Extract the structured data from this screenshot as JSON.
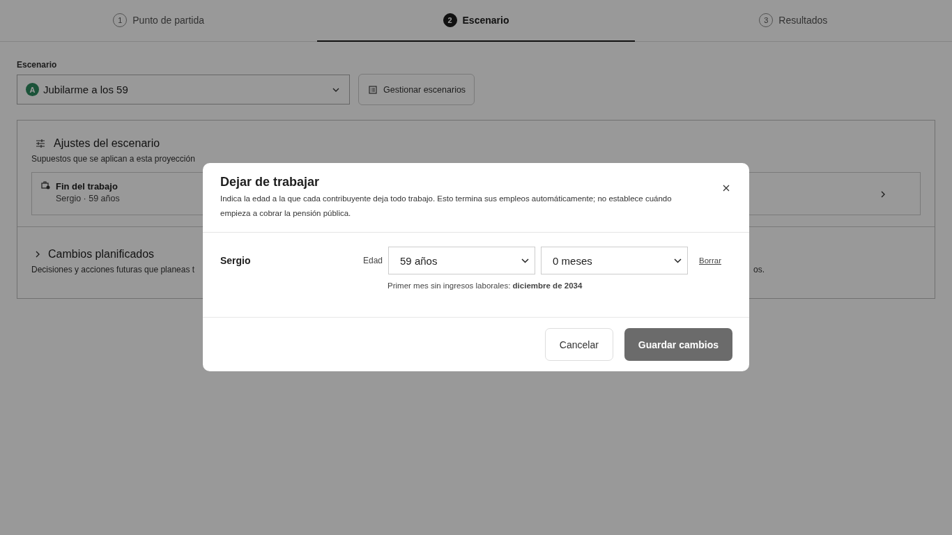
{
  "tabs": [
    {
      "number": "1",
      "label": "Punto de partida",
      "selected": false
    },
    {
      "number": "2",
      "label": "Escenario",
      "selected": true
    },
    {
      "number": "3",
      "label": "Resultados",
      "selected": false
    }
  ],
  "scenario": {
    "label": "Escenario",
    "badge": "A",
    "value": "Jubilarme a los 59",
    "manage_button": "Gestionar escenarios"
  },
  "settings": {
    "title": "Ajustes del escenario",
    "description": "Supuestos que se aplican a esta proyección",
    "items": [
      {
        "title": "Fin del trabajo",
        "subtitle": "Sergio · 59 años"
      }
    ]
  },
  "planned": {
    "title": "Cambios planificados",
    "expanded": false,
    "description_start": "Decisiones y acciones futuras que planeas t",
    "description_end": "os."
  },
  "dialog": {
    "title": "Dejar de trabajar",
    "description": "Indica la edad a la que cada contribuyente deja todo trabajo. Esto termina sus empleos automáticamente; no establece cuándo empieza a cobrar la pensión pública.",
    "rows": [
      {
        "person": "Sergio",
        "field_label": "Edad",
        "years": "59 años",
        "months": "0 meses",
        "clear_link": "Borrar",
        "note": "Primer mes sin ingresos laborales: **diciembre de 2034**"
      }
    ],
    "cancel_button": "Cancelar",
    "save_button": "Guardar cambios"
  }
}
